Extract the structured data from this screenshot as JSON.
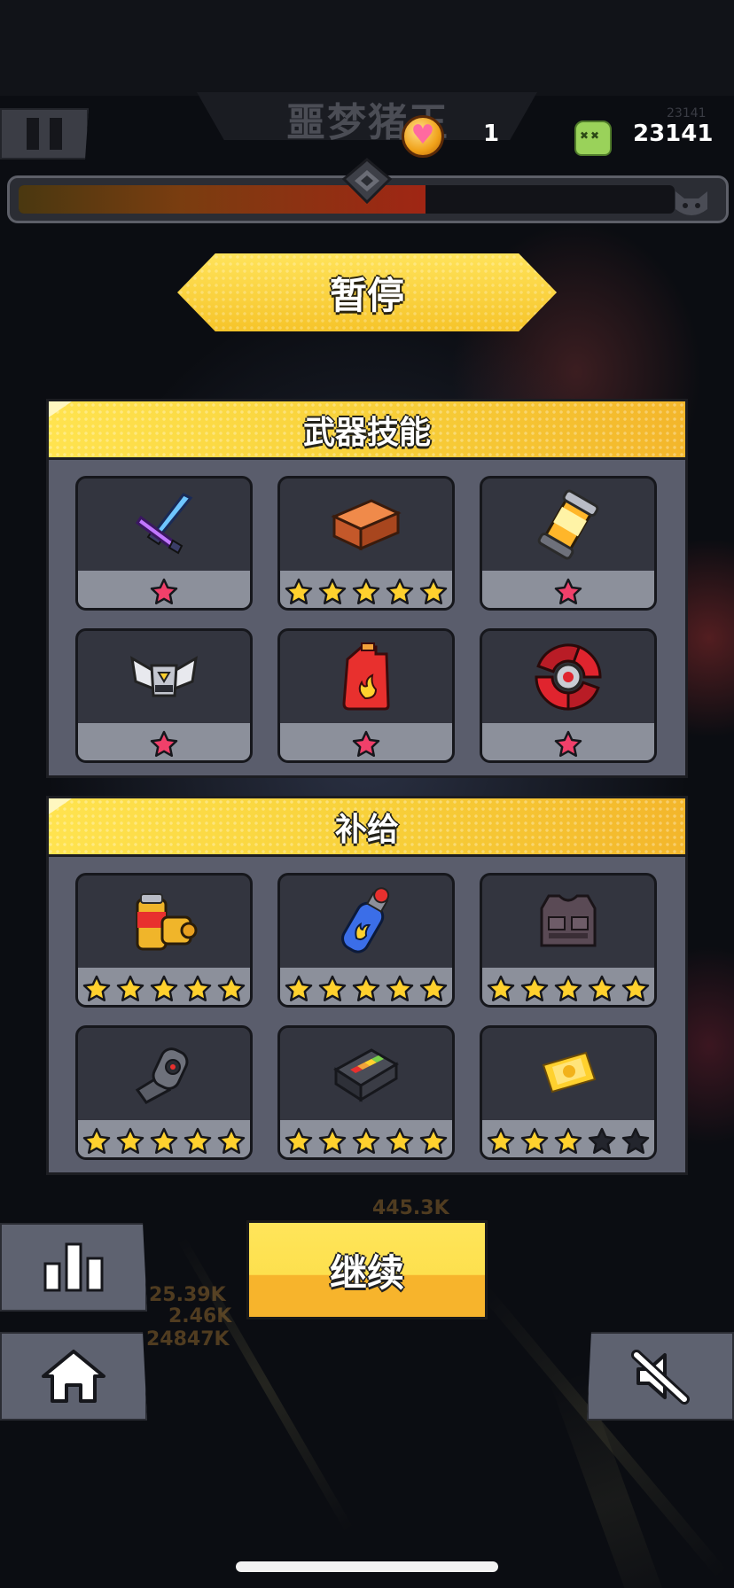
{
  "hud": {
    "boss_name": "噩梦猪王",
    "lives": "1",
    "kills": "23141",
    "kills_ghost": "23141",
    "boss_health_fraction": 0.62,
    "icons": [
      "pause-icon",
      "heart-coin-icon",
      "zombie-kill-icon",
      "boss-marker-icon",
      "cat-boss-icon"
    ]
  },
  "pause_title": "暂停",
  "weapons": {
    "title": "武器技能",
    "items": [
      {
        "icon": "twin-blades-icon",
        "stars": 1,
        "max": 1,
        "color": "pink"
      },
      {
        "icon": "brick-icon",
        "stars": 5,
        "max": 5,
        "color": "gold"
      },
      {
        "icon": "grenade-canister-icon",
        "stars": 1,
        "max": 1,
        "color": "pink"
      },
      {
        "icon": "drone-guard-icon",
        "stars": 1,
        "max": 1,
        "color": "pink"
      },
      {
        "icon": "fuel-can-icon",
        "stars": 1,
        "max": 1,
        "color": "pink"
      },
      {
        "icon": "spinning-blade-icon",
        "stars": 1,
        "max": 1,
        "color": "pink"
      }
    ]
  },
  "supplies": {
    "title": "补给",
    "items": [
      {
        "icon": "battery-canister-icon",
        "stars": 5,
        "max": 5,
        "color": "gold"
      },
      {
        "icon": "fire-extinguisher-icon",
        "stars": 5,
        "max": 5,
        "color": "gold"
      },
      {
        "icon": "armor-vest-icon",
        "stars": 5,
        "max": 5,
        "color": "gold"
      },
      {
        "icon": "robot-arm-icon",
        "stars": 5,
        "max": 5,
        "color": "gold"
      },
      {
        "icon": "energy-battery-icon",
        "stars": 5,
        "max": 5,
        "color": "gold"
      },
      {
        "icon": "gold-ticket-icon",
        "stars": 3,
        "max": 5,
        "color": "gold"
      }
    ]
  },
  "buttons": {
    "continue": "继续",
    "stats_icon": "bar-chart-icon",
    "home_icon": "home-icon",
    "mute_icon": "mute-icon"
  },
  "background_damage": [
    "25.39K",
    "2.46K",
    "24847K",
    "445.3K"
  ],
  "colors": {
    "accent_yellow": "#fde04e",
    "panel_bg": "#5a5d6c",
    "card_bg": "#33353f",
    "star_pink": "#f0406a",
    "star_gold": "#ffd12e",
    "star_empty": "#23252d"
  }
}
